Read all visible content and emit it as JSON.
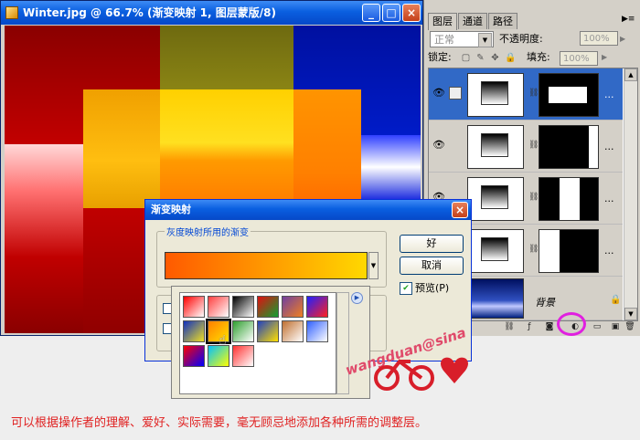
{
  "image_window": {
    "title": "Winter.jpg @ 66.7% (渐变映射 1, 图层蒙版/8)",
    "buttons": {
      "minimize": "_",
      "maximize": "□",
      "close": "×"
    }
  },
  "layers_panel": {
    "tabs": [
      {
        "label": "图层",
        "active": true
      },
      {
        "label": "通道",
        "active": false
      },
      {
        "label": "路径",
        "active": false
      }
    ],
    "blend_mode": "正常",
    "opacity_label": "不透明度:",
    "opacity_value": "100%",
    "lock_label": "锁定:",
    "fill_label": "填充:",
    "fill_value": "100%",
    "layers": [
      {
        "kind": "gradient-map",
        "active": true
      },
      {
        "kind": "gradient-map",
        "active": false
      },
      {
        "kind": "gradient-map",
        "active": false
      },
      {
        "kind": "gradient-map",
        "active": false
      },
      {
        "kind": "background",
        "name": "背景",
        "active": false
      }
    ],
    "row_menu_glyph": "...",
    "bottom_buttons": [
      "link-icon",
      "fx-icon",
      "mask-icon",
      "adjustment-layer-icon",
      "group-icon",
      "new-layer-icon",
      "trash-icon"
    ]
  },
  "gradient_map_dialog": {
    "title": "渐变映射",
    "group_label": "灰度映射所用的渐变",
    "ok_label": "好",
    "cancel_label": "取消",
    "preview_label": "预览(P)",
    "preview_checked": true,
    "gradient_colors": [
      "#ff5a00",
      "#ffd800"
    ]
  },
  "gradient_picker": {
    "presets": [
      [
        "#ff0000",
        "#ffffff"
      ],
      [
        "#ff4040",
        "#ffffff"
      ],
      [
        "#000000",
        "#ffffff"
      ],
      [
        "#e01010",
        "#10a030"
      ],
      [
        "#7040a0",
        "#f08020"
      ],
      [
        "#2020ff",
        "#ff2020"
      ],
      [
        "#1030c0",
        "#f0e020"
      ],
      [
        "#ff8000",
        "#ffe000"
      ],
      [
        "#30a030",
        "#ffffff"
      ],
      [
        "#2040c0",
        "#ffe000"
      ],
      [
        "#c07030",
        "#ffffff"
      ],
      [
        "#3060ff",
        "#ffffff"
      ],
      [
        "#ff0000",
        "#0000ff"
      ],
      [
        "#00c0ff",
        "#ffff00"
      ],
      [
        "#ff3030",
        "#ffffff"
      ]
    ]
  },
  "watermark_text": "wangduan@sina",
  "caption": "可以根据操作者的理解、爱好、实际需要，毫无顾忌地添加各种所需的调整层。"
}
